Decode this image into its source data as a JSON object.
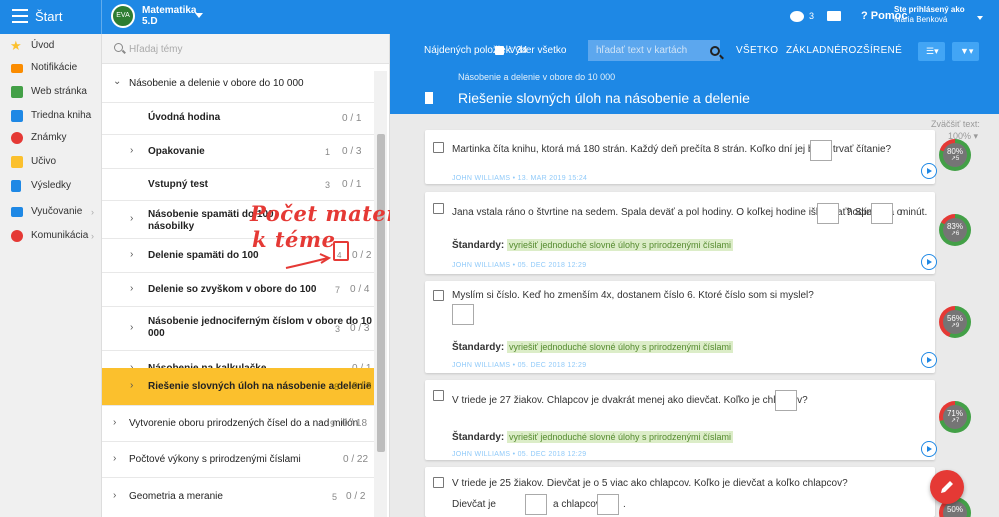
{
  "topbar": {
    "start_label": "Štart",
    "subject_logo_text": "EVA",
    "subject": "Matematika",
    "class": "5.D",
    "messages_count": "3",
    "help_label": "Pomoc",
    "user_status": "Ste prihlásený ako",
    "user_name": "Mária Benková"
  },
  "sidebar": {
    "items": [
      {
        "label": "Úvod",
        "icon": "star-icon",
        "color": "#fbc02d"
      },
      {
        "label": "Notifikácie",
        "icon": "mail-icon",
        "color": "#fb8c00"
      },
      {
        "label": "Web stránka",
        "icon": "home-icon",
        "color": "#43a047"
      },
      {
        "label": "Triedna kniha",
        "icon": "book-icon",
        "color": "#1e88e5"
      },
      {
        "label": "Známky",
        "icon": "grades-icon",
        "color": "#e53935"
      },
      {
        "label": "Učivo",
        "icon": "curriculum-icon",
        "color": "#fbc02d"
      },
      {
        "label": "Výsledky",
        "icon": "chart-icon",
        "color": "#1e88e5"
      },
      {
        "label": "Vyučovanie",
        "icon": "teaching-icon",
        "color": "#1e88e5"
      },
      {
        "label": "Komunikácia",
        "icon": "chat-icon",
        "color": "#e53935"
      }
    ]
  },
  "topics": {
    "search_placeholder": "Hľadaj témy",
    "rows": [
      {
        "label": "Násobenie a delenie v obore do 10 000",
        "chevron": "⌄",
        "count": "",
        "fraction": ""
      },
      {
        "label": "Úvodná hodina",
        "chevron": "",
        "count": "",
        "fraction": "0 / 1"
      },
      {
        "label": "Opakovanie",
        "chevron": "›",
        "count": "1",
        "fraction": "0 / 3"
      },
      {
        "label": "Vstupný test",
        "chevron": "",
        "count": "3",
        "fraction": "0 / 1"
      },
      {
        "label": "Násobenie spamäti do 100",
        "label2": "násobilky",
        "chevron": "›",
        "count": "",
        "fraction": ""
      },
      {
        "label": "Delenie spamäti do 100",
        "chevron": "›",
        "count": "4",
        "fraction": "0 / 2"
      },
      {
        "label": "Delenie so zvyškom v obore do 100",
        "chevron": "›",
        "count": "7",
        "fraction": "0 / 4"
      },
      {
        "label": "Násobenie jednociferným číslom v obore do 10",
        "label2": "000",
        "chevron": "›",
        "count": "3",
        "fraction": "0 / 3"
      },
      {
        "label": "Násobenie na kalkulačke",
        "chevron": "›",
        "count": "",
        "fraction": "0 / 1"
      },
      {
        "label": "Riešenie slovných úloh na násobenie a delenie",
        "chevron": "›",
        "count": "8",
        "fraction": "0 / 3"
      },
      {
        "label": "Vytvorenie oboru prirodzených čísel do a nad milión",
        "chevron": "›",
        "count": "9",
        "fraction": "0 / 18"
      },
      {
        "label": "Počtové výkony s prirodzenými číslami",
        "chevron": "›",
        "count": "",
        "fraction": "0 / 22"
      },
      {
        "label": "Geometria a meranie",
        "chevron": "›",
        "count": "5",
        "fraction": "0 / 2"
      }
    ],
    "annotation_line1": "Počet materiálov",
    "annotation_line2": "k téme"
  },
  "filterbar": {
    "found_label": "Nájdených položiek: 34",
    "select_all": "Vyber všetko",
    "search_placeholder": "hľadať text v kartách",
    "tabs": [
      "VŠETKO",
      "ZÁKLADNÉ",
      "ROZŠÍRENÉ"
    ]
  },
  "header": {
    "breadcrumb": "Násobenie a delenie v obore do 10 000",
    "title": "Riešenie slovných úloh na násobenie a delenie"
  },
  "zoom": {
    "label": "Zväčšiť text:",
    "value": "100%"
  },
  "cards": [
    {
      "text": "Martinka číta knihu, ktorá má 180 strán. Každý deň prečíta 8 strán. Koľko dní jej bude trvať čítanie?",
      "meta": "JOHN WILLIAMS  •  13. MAR 2019 15:24",
      "percent": "80%",
      "attempts": "5"
    },
    {
      "text": "Jana vstala ráno o štvrtine na sedem. Spala deväť a pol hodiny. O koľkej hodine išla spať? Spať išla o",
      "word_hours": "hodín",
      "word_minutes": "minút.",
      "standard_label": "Štandardy:",
      "standard": "vyriešiť jednoduché slovné úlohy s prirodzenými číslami",
      "meta": "JOHN WILLIAMS  •  05. DEC 2018 12:29",
      "percent": "83%",
      "attempts": "6"
    },
    {
      "text": "Myslím si číslo. Keď ho zmenším 4x, dostanem číslo 6. Ktoré číslo som si myslel?",
      "standard_label": "Štandardy:",
      "standard": "vyriešiť jednoduché slovné úlohy s prirodzenými číslami",
      "meta": "JOHN WILLIAMS  •  05. DEC 2018 12:29",
      "percent": "56%",
      "attempts": "9"
    },
    {
      "text": "V triede je 27 žiakov. Chlapcov je dvakrát menej ako dievčat. Koľko je chlapcov?",
      "standard_label": "Štandardy:",
      "standard": "vyriešiť jednoduché slovné úlohy s prirodzenými číslami",
      "meta": "JOHN WILLIAMS  •  05. DEC 2018 12:29",
      "percent": "71%",
      "attempts": "7"
    },
    {
      "text": "V triede je 25 žiakov. Dievčat je o 5 viac ako chlapcov. Koľko je dievčat a koľko chlapcov?",
      "girls_label": "Dievčat je",
      "boys_label": "a chlapcov",
      "period": ".",
      "percent": "50%",
      "attempts": ""
    }
  ],
  "colors": {
    "primary": "#1e88e5",
    "active_topic": "#fbc02d",
    "annotation": "#e53935",
    "standard_bg": "#dcedc8"
  }
}
